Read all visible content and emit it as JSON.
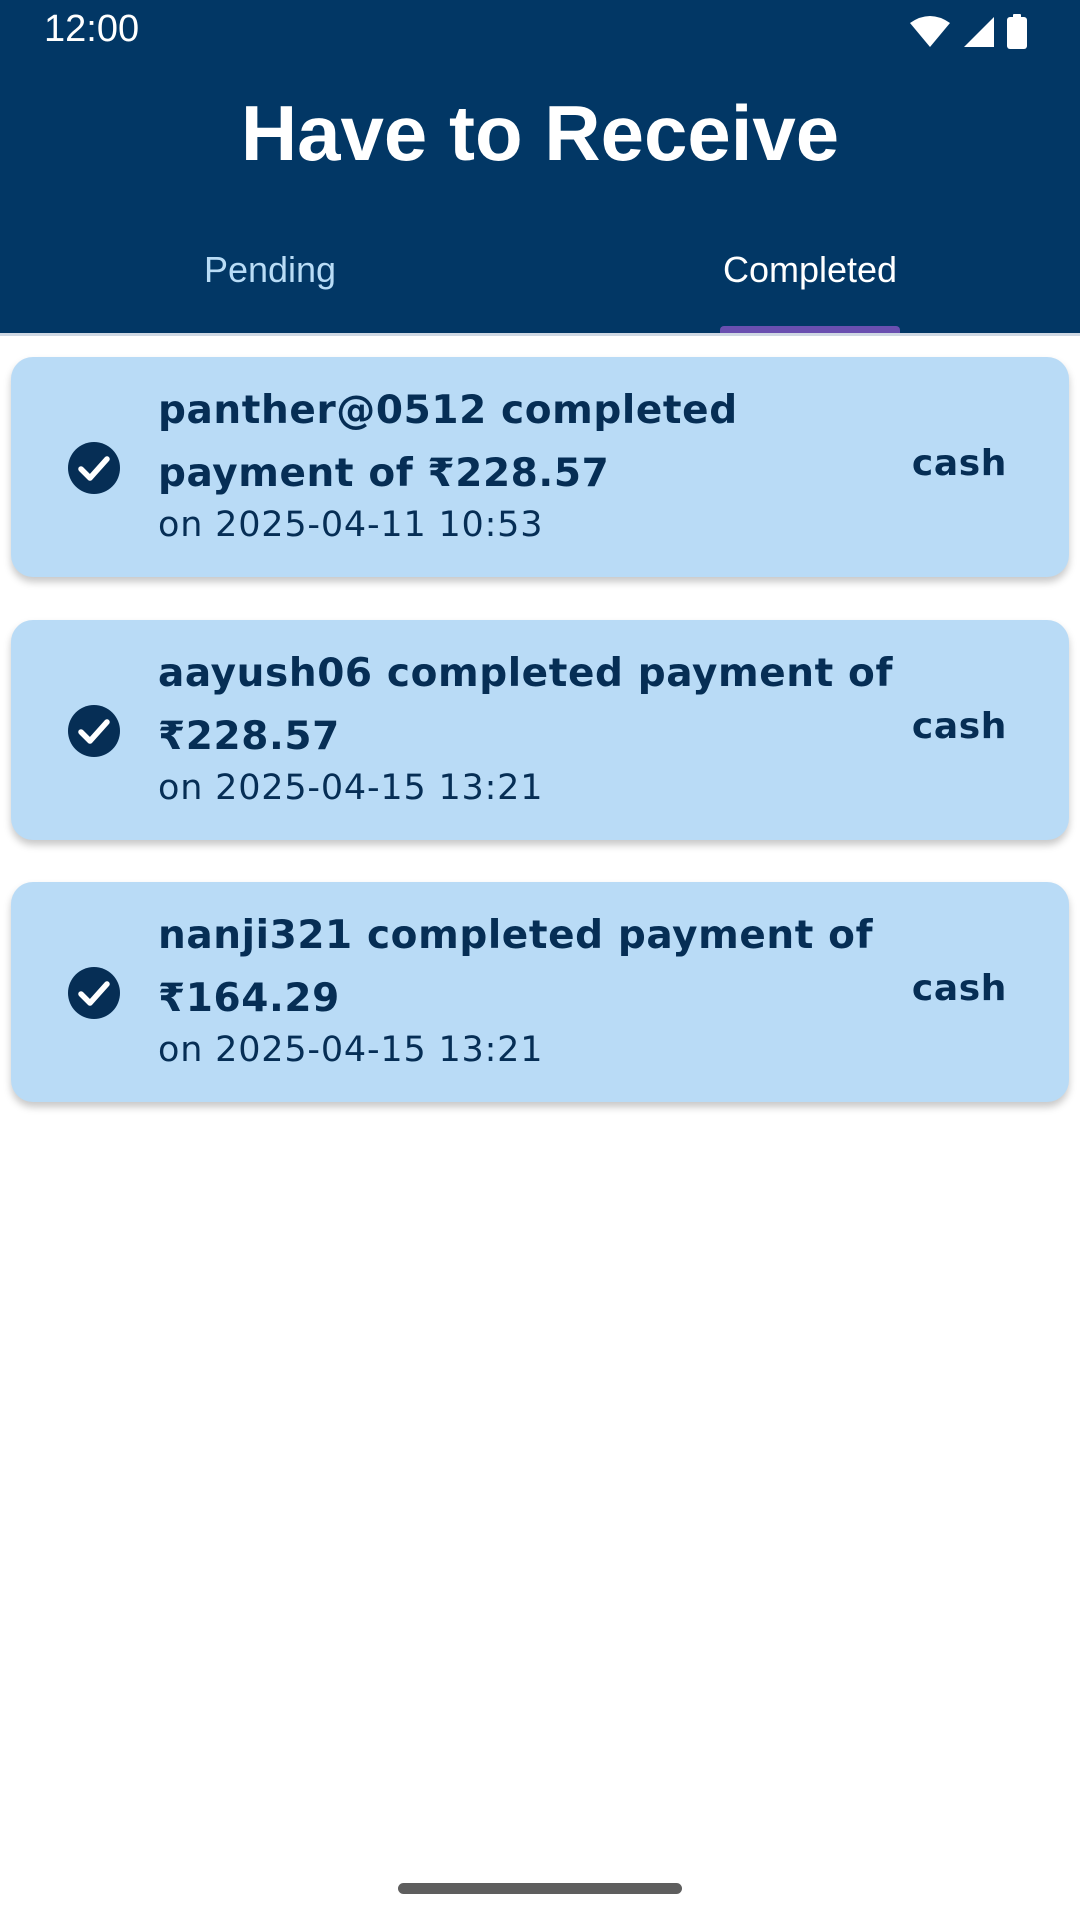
{
  "status_bar": {
    "time": "12:00",
    "icons": [
      "wifi-icon",
      "signal-icon",
      "battery-icon"
    ]
  },
  "header": {
    "title": "Have to Receive"
  },
  "tabs": [
    {
      "label": "Pending",
      "selected": false
    },
    {
      "label": "Completed",
      "selected": true
    }
  ],
  "payments": [
    {
      "icon": "check-circle-icon",
      "line1": "panther@0512 completed",
      "line2": "payment of ₹228.57",
      "timestamp": "on 2025-04-11 10:53",
      "method": "cash"
    },
    {
      "icon": "check-circle-icon",
      "line1": "aayush06 completed payment of",
      "line2": "₹228.57",
      "timestamp": "on 2025-04-15 13:21",
      "method": "cash"
    },
    {
      "icon": "check-circle-icon",
      "line1": "nanji321 completed payment of",
      "line2": "₹164.29",
      "timestamp": "on 2025-04-15 13:21",
      "method": "cash"
    }
  ],
  "colors": {
    "header_bg": "#023765",
    "card_bg": "#b9dbf6",
    "card_text": "#062e55",
    "tab_indicator": "#6a4fb0"
  }
}
